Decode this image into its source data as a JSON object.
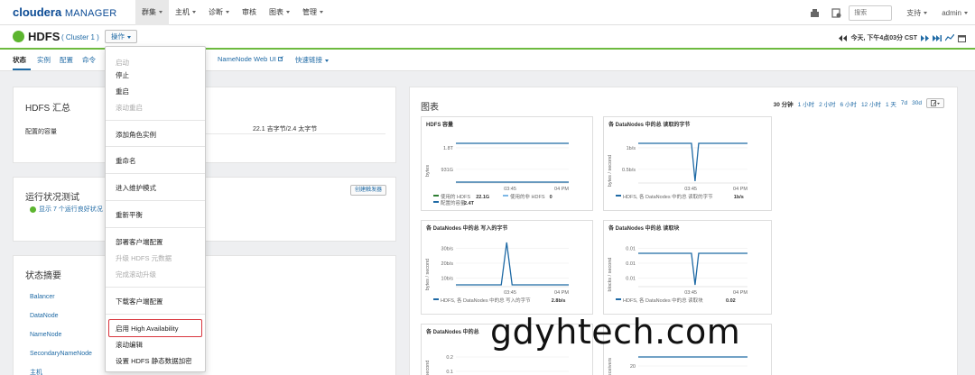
{
  "app": {
    "logo_brand": "cloudera",
    "logo_product": "MANAGER"
  },
  "nav": {
    "items": [
      {
        "label": "群集",
        "active": true,
        "caret": true
      },
      {
        "label": "主机",
        "active": false,
        "caret": true
      },
      {
        "label": "诊断",
        "active": false,
        "caret": true
      },
      {
        "label": "审核",
        "active": false,
        "caret": false
      },
      {
        "label": "图表",
        "active": false,
        "caret": true
      },
      {
        "label": "管理",
        "active": false,
        "caret": true
      }
    ],
    "search_placeholder": "搜索",
    "support_label": "支持",
    "user_label": "admin"
  },
  "service": {
    "name": "HDFS",
    "cluster": "( Cluster 1 )",
    "actions_label": "操作",
    "status_color": "#5cb52f",
    "time_text": "今天, 下午4点03分 CST"
  },
  "tabs": [
    {
      "label": "状态",
      "active": true
    },
    {
      "label": "实例",
      "active": false
    },
    {
      "label": "配置",
      "active": false
    },
    {
      "label": "命令",
      "active": false
    },
    {
      "label": "NameNode Web UI",
      "active": false
    },
    {
      "label": "快速链接",
      "active": false
    }
  ],
  "summary": {
    "title": "HDFS 汇总",
    "capacity_label": "配置的容量",
    "capacity_value": "22.1 吉字节/2.4 太字节"
  },
  "health": {
    "title": "运行状况测试",
    "create_trigger": "创建触发器",
    "passed_text": "显示 7 个运行良好状况"
  },
  "status_summary": {
    "title": "状态摘要",
    "items": [
      "Balancer",
      "DataNode",
      "NameNode",
      "SecondaryNameNode",
      "主机"
    ]
  },
  "charts_panel": {
    "title": "图表",
    "ranges": [
      "30 分钟",
      "1 小时",
      "2 小时",
      "6 小时",
      "12 小时",
      "1 天",
      "7d",
      "30d"
    ],
    "current_range": "30 分钟"
  },
  "dropdown": {
    "items": [
      {
        "label": "启动",
        "disabled": true
      },
      {
        "label": "停止",
        "disabled": false
      },
      {
        "label": "重启",
        "disabled": false
      },
      {
        "label": "滚动重启",
        "disabled": true
      },
      {
        "label": "添加角色实例",
        "disabled": false
      },
      {
        "label": "重命名",
        "disabled": false
      },
      {
        "label": "进入维护模式",
        "disabled": false
      },
      {
        "label": "重新平衡",
        "disabled": false
      },
      {
        "label": "部署客户端配置",
        "disabled": false
      },
      {
        "label": "升级 HDFS 元数据",
        "disabled": true
      },
      {
        "label": "完成滚动升级",
        "disabled": true
      },
      {
        "label": "下载客户端配置",
        "disabled": false
      },
      {
        "label": "启用 High Availability",
        "disabled": false,
        "highlighted": true
      },
      {
        "label": "滚动编辑",
        "disabled": false
      },
      {
        "label": "设置 HDFS 静态数据加密",
        "disabled": false
      }
    ]
  },
  "chart_data": [
    {
      "type": "line",
      "title": "HDFS 容量",
      "ylabel": "bytes",
      "ytick_labels": [
        "1.8T",
        "931G"
      ],
      "xtick_labels": [
        "03:45",
        "04 PM"
      ],
      "series": [
        {
          "name": "使用的 HDFS",
          "value_label": "22.1G",
          "color": "#2e7d32"
        },
        {
          "name": "使用的非 HDFS",
          "value_label": "0",
          "color": "#7cb7e6"
        },
        {
          "name": "配置的容量",
          "value_label": "2.4T",
          "color": "#1f6aa5"
        }
      ],
      "trend": "flat"
    },
    {
      "type": "line",
      "title": "各 DataNodes 中的总 读取的字节",
      "ylabel": "bytes / second",
      "ytick_labels": [
        "1b/s",
        "0.5b/s"
      ],
      "xtick_labels": [
        "03:45",
        "04 PM"
      ],
      "series": [
        {
          "name": "HDFS, 各 DataNodes 中的总 读取的字节",
          "value_label": "1b/s",
          "color": "#1f6aa5"
        }
      ],
      "trend": "flat with dip to 0 near 03:50"
    },
    {
      "type": "line",
      "title": "各 DataNodes 中的总 写入的字节",
      "ylabel": "bytes / second",
      "ytick_labels": [
        "30b/s",
        "20b/s",
        "10b/s"
      ],
      "xtick_labels": [
        "03:45",
        "04 PM"
      ],
      "series": [
        {
          "name": "HDFS, 各 DataNodes 中的总 写入的字节",
          "value_label": "2.8b/s",
          "color": "#1f6aa5"
        }
      ],
      "trend": "low with spike to ~33b/s near 03:45"
    },
    {
      "type": "line",
      "title": "各 DataNodes 中的总 读取块",
      "ylabel": "blocks / second",
      "ytick_labels": [
        "0.01",
        "0.01",
        "0.01"
      ],
      "xtick_labels": [
        "03:45",
        "04 PM"
      ],
      "series": [
        {
          "name": "HDFS, 各 DataNodes 中的总 读取块",
          "value_label": "0.02",
          "color": "#1f6aa5"
        }
      ],
      "trend": "flat with dip to 0 near 03:50"
    },
    {
      "type": "line",
      "title": "各 DataNodes 中的总",
      "ylabel": "/ second",
      "ytick_labels": [
        "0.2",
        "0.1"
      ],
      "xtick_labels": [],
      "series": [],
      "trend": "partially visible"
    },
    {
      "type": "line",
      "title": "",
      "ylabel": "receivers",
      "ytick_labels": [
        "20",
        "10"
      ],
      "xtick_labels": [],
      "series": [],
      "trend": "partially visible"
    }
  ],
  "watermark": "gdyhtech.com"
}
